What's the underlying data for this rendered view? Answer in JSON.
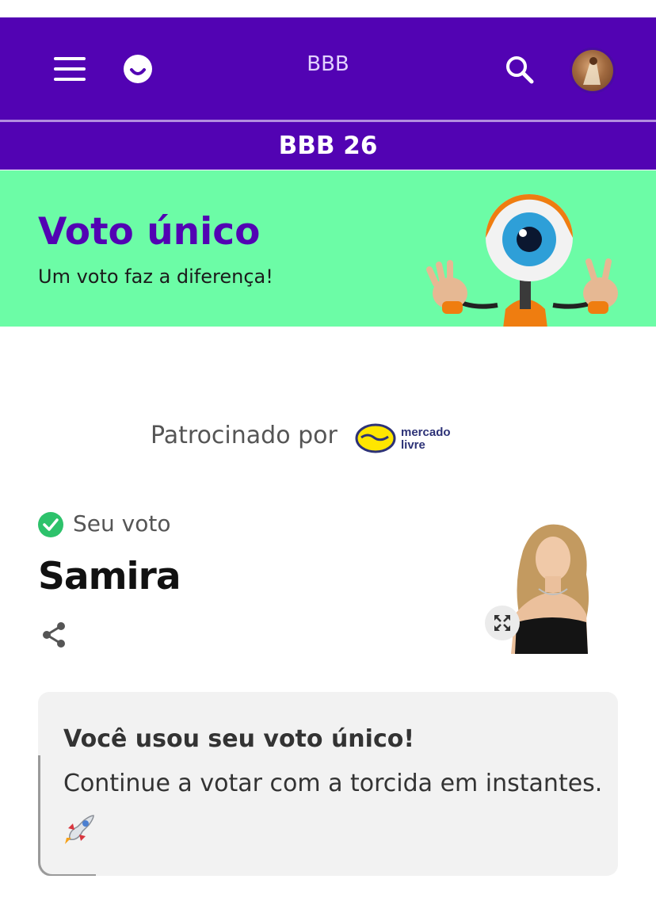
{
  "header": {
    "title": "BBB",
    "section_title": "BBB 26",
    "icons": [
      "menu-icon",
      "globo-logo-icon",
      "search-icon",
      "avatar"
    ]
  },
  "banner": {
    "title": "Voto único",
    "subtitle": "Um voto faz a diferença!",
    "background": "#6cfca6",
    "title_color": "#5203b3"
  },
  "sponsor": {
    "label": "Patrocinado por",
    "logo_line1": "mercado",
    "logo_line2": "livre"
  },
  "vote": {
    "status_label": "Seu voto",
    "candidate": "Samira",
    "icons": [
      "check-circle-icon",
      "share-icon",
      "expand-icon"
    ]
  },
  "card": {
    "title": "Você usou seu voto único!",
    "text": "Continue a votar com a torcida em instantes.",
    "emoji": "rocket-icon"
  },
  "colors": {
    "brand_purple": "#5203b3",
    "check_green": "#2dc26b",
    "card_bg": "#f2f2f2"
  }
}
